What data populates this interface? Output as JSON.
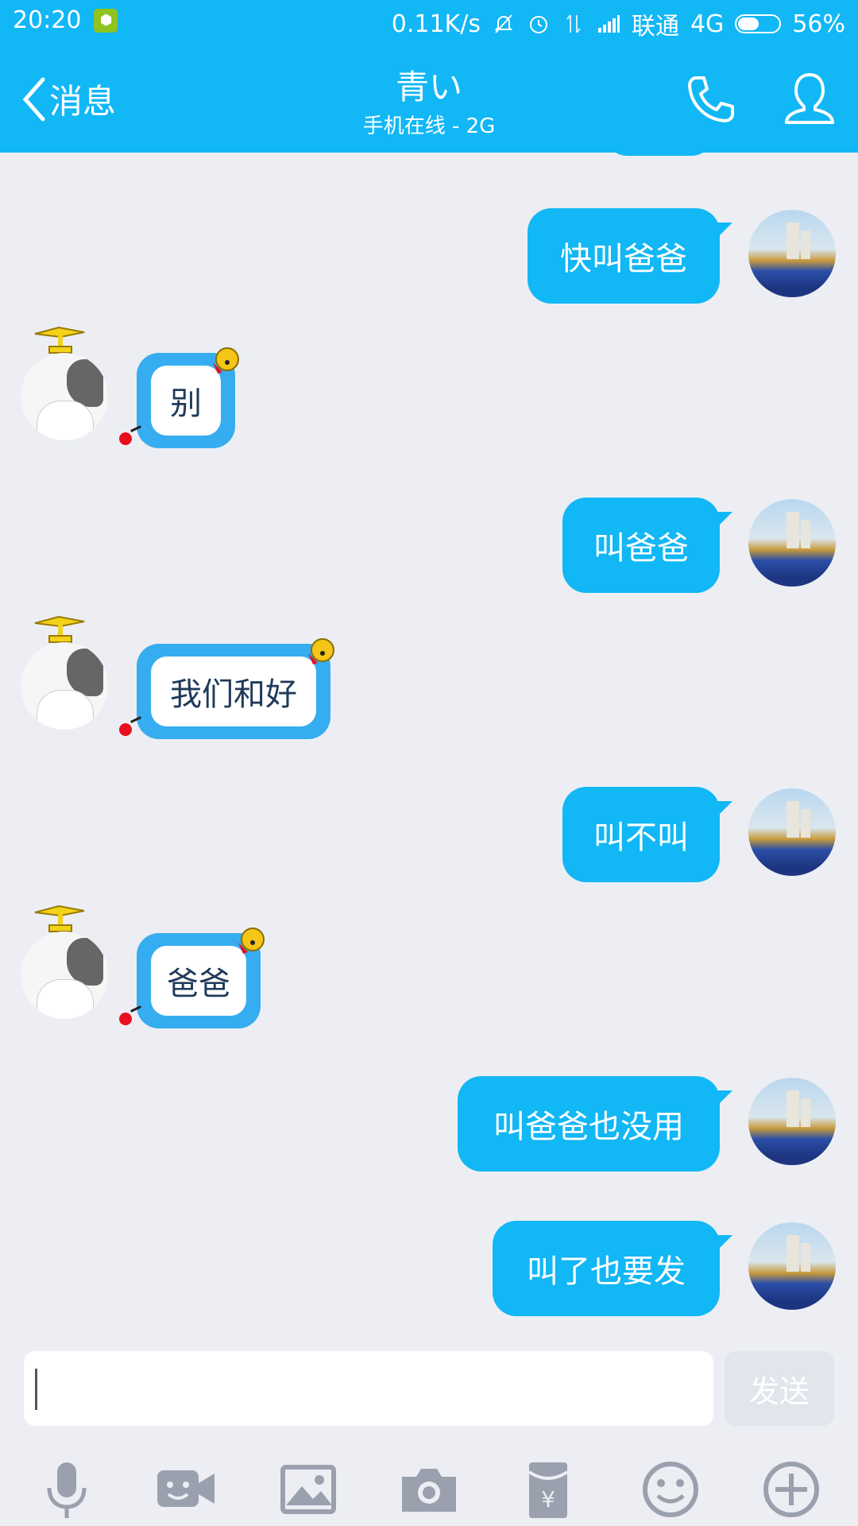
{
  "status_bar": {
    "time": "20:20",
    "net_speed": "0.11K/s",
    "carrier": "联通",
    "network": "4G",
    "battery": "56%",
    "battery_level": 0.56
  },
  "header": {
    "back_label": "消息",
    "contact_name": "青い",
    "contact_status": "手机在线 - 2G"
  },
  "messages": [
    {
      "side": "right",
      "text": "快叫爸爸"
    },
    {
      "side": "left",
      "text": "别"
    },
    {
      "side": "right",
      "text": "叫爸爸"
    },
    {
      "side": "left",
      "text": "我们和好"
    },
    {
      "side": "right",
      "text": "叫不叫"
    },
    {
      "side": "left",
      "text": "爸爸"
    },
    {
      "side": "right",
      "text": "叫爸爸也没用"
    },
    {
      "side": "right",
      "text": "叫了也要发"
    }
  ],
  "input": {
    "value": "",
    "send_label": "发送"
  },
  "toolbar": [
    "mic-icon",
    "video-icon",
    "image-icon",
    "camera-icon",
    "red-packet-icon",
    "emoji-icon",
    "plus-icon"
  ],
  "colors": {
    "brand": "#12b7f5",
    "background": "#eceef4",
    "left_bubble": "#36adf0"
  }
}
